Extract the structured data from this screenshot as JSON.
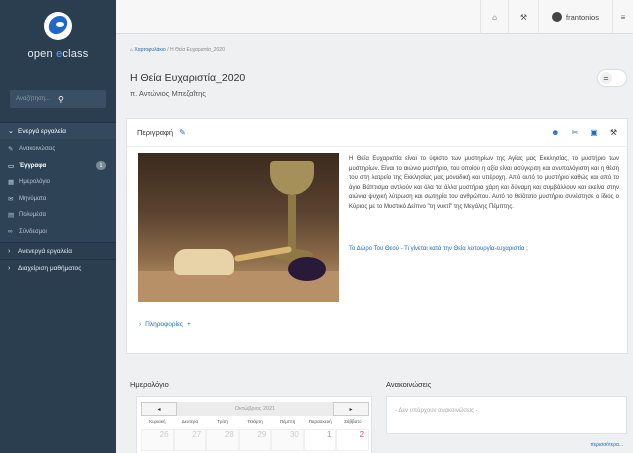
{
  "sidebar": {
    "logo_prefix": "open ",
    "logo_accent": "e",
    "logo_suffix": "class",
    "search_placeholder": "Αναζήτηση...",
    "active_tools_label": "Ενεργά εργαλεία",
    "items": [
      {
        "label": "Ανακοινώσεις",
        "icon": "megaphone-icon"
      },
      {
        "label": "Έγγραφα",
        "icon": "folder-icon",
        "badge": "1"
      },
      {
        "label": "Ημερολόγιο",
        "icon": "calendar-icon"
      },
      {
        "label": "Μηνύματα",
        "icon": "envelope-icon"
      },
      {
        "label": "Πολυμέσα",
        "icon": "film-icon"
      },
      {
        "label": "Σύνδεσμοι",
        "icon": "link-icon"
      }
    ],
    "inactive_tools_label": "Ανενεργά εργαλεία",
    "course_admin_label": "Διαχείριση μαθήματος"
  },
  "topbar": {
    "username": "frantonios"
  },
  "breadcrumb": {
    "home": "Χαρτοφυλάκιο",
    "separator": "/",
    "current": "Η Θεία Ευχαριστία_2020"
  },
  "course": {
    "title": "Η Θεία Ευχαριστία_2020",
    "teacher": "π. Αντώνιος Μπεζαΐτης"
  },
  "description": {
    "heading": "Περιγραφή",
    "text": "Η Θεία Ευχαριστία είναι το ύψιστο των μυστηρίων της Αγίας μας Εκκλησίας, το μυστήριο των μυστηρίων. Είναι το αιώνιο μυστήριο, του οποίου η αξία είναι ασύγκριτη και ανυπολόγιστη και η θέση του στη λατρεία της Εκκλησίας μας μοναδική και υπέροχη. Από αυτό το μυστήριο καθώς και από το άγιο Βάπτισμα αντλούν και όλα τα άλλα μυστήρια χάρη και δύναμη και συμβάλλουν και εκείνα στην αιώνια ψυχική λύτρωση και σωτηρία του ανθρώπου. Αυτό το θεϊότατο μυστήριο συνέστησε ο ίδιος ο Κύριος με το Μυστικό Δείπνο \"τη νυκτί\" της Μεγάλης Πέμπτης.",
    "link": "Το Δώρο Του Θεού - Τι γίνεται κατά την Θεία λειτουργία-ευχαριστία ;",
    "info_label": "Πληροφορίες",
    "info_plus": "+"
  },
  "calendar": {
    "title": "Ημερολόγιο",
    "prev": "◂",
    "next": "▸",
    "month": "Οκτώβριος 2021",
    "weekdays": [
      "Κυριακή",
      "Δευτέρα",
      "Τρίτη",
      "Τετάρτη",
      "Πέμπτη",
      "Παρασκευή",
      "Σάββατο"
    ],
    "dates": [
      "26",
      "27",
      "28",
      "29",
      "30",
      "1",
      "2"
    ]
  },
  "announcements": {
    "title": "Ανακοινώσεις",
    "empty": "- Δεν υπάρχουν ανακοινώσεις -",
    "more": "περισσότερα..."
  }
}
